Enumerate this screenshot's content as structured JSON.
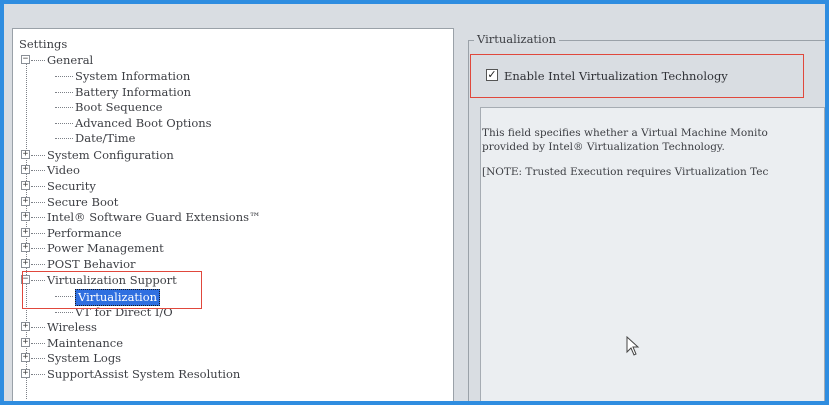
{
  "tree": {
    "title": "Settings",
    "items": [
      {
        "label": "General",
        "expander": "−"
      },
      {
        "label": "System Information"
      },
      {
        "label": "Battery Information"
      },
      {
        "label": "Boot Sequence"
      },
      {
        "label": "Advanced Boot Options"
      },
      {
        "label": "Date/Time"
      },
      {
        "label": "System Configuration",
        "expander": "+"
      },
      {
        "label": "Video",
        "expander": "+"
      },
      {
        "label": "Security",
        "expander": "+"
      },
      {
        "label": "Secure Boot",
        "expander": "+"
      },
      {
        "label": "Intel® Software Guard Extensions™",
        "expander": "+"
      },
      {
        "label": "Performance",
        "expander": "+"
      },
      {
        "label": "Power Management",
        "expander": "+"
      },
      {
        "label": "POST Behavior",
        "expander": "+"
      },
      {
        "label": "Virtualization Support",
        "expander": "−"
      },
      {
        "label": "Virtualization",
        "selected": true
      },
      {
        "label": "VT for Direct I/O"
      },
      {
        "label": "Wireless",
        "expander": "+"
      },
      {
        "label": "Maintenance",
        "expander": "+"
      },
      {
        "label": "System Logs",
        "expander": "+"
      },
      {
        "label": "SupportAssist System Resolution",
        "expander": "+"
      }
    ]
  },
  "panel": {
    "group_title": "Virtualization",
    "checkbox_label": "Enable Intel Virtualization Technology",
    "checkbox_checked": true,
    "checkbox_mark": "✓",
    "description": {
      "line1": "This field specifies whether a Virtual Machine Monito",
      "line2": "provided by Intel® Virtualization Technology.",
      "note": "[NOTE: Trusted Execution requires Virtualization Tec"
    }
  },
  "colors": {
    "highlight": "#e0483c",
    "selection": "#2f6fe0"
  },
  "icons": {
    "cursor": "mouse-pointer-icon"
  }
}
